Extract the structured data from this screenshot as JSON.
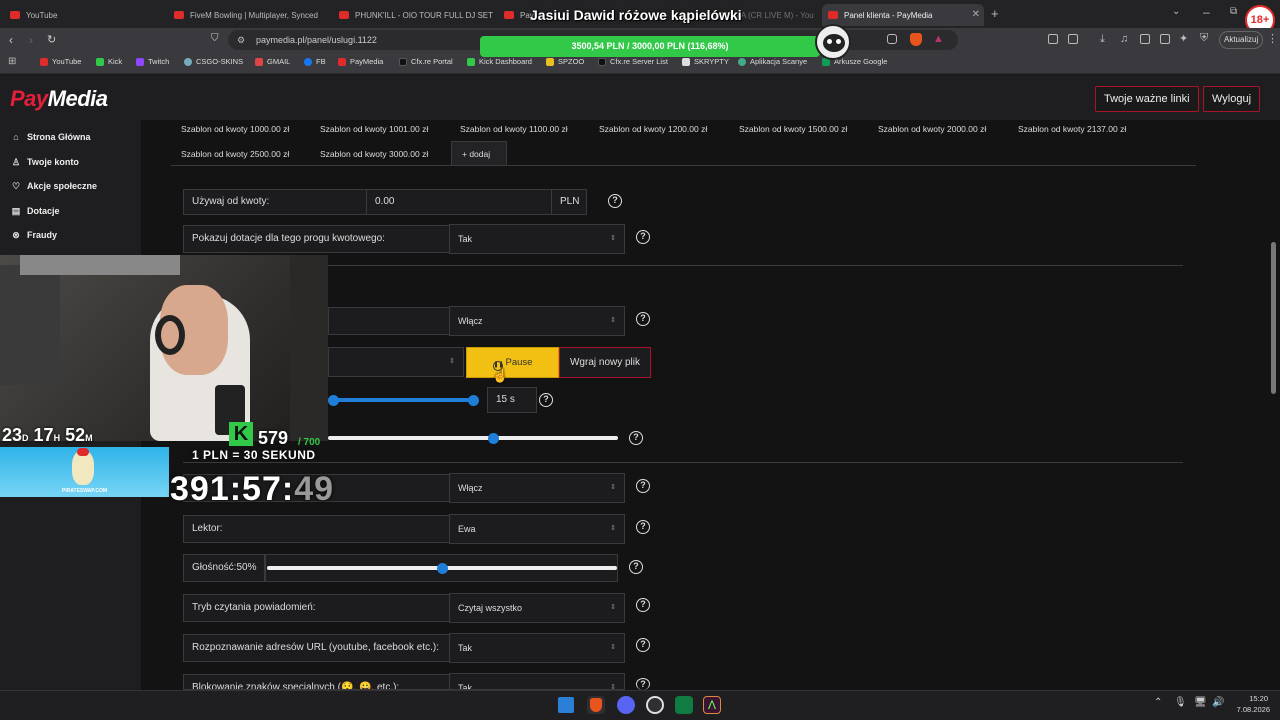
{
  "browser": {
    "tabs": [
      {
        "label": "YouTube"
      },
      {
        "label": "FiveM Bowling | Multiplayer, Synced"
      },
      {
        "label": "PHUNK'ILL - OIO TOUR FULL DJ SET"
      },
      {
        "label": "Pay"
      },
      {
        "label": "PAYMEDIA (CR LIVE M) - You"
      },
      {
        "label": "Panel klienta - PayMedia",
        "active": true
      }
    ],
    "url": "paymedia.pl/panel/uslugi.1122",
    "update_label": "Aktualizuj",
    "bookmarks": [
      "YouTube",
      "Kick",
      "Twitch",
      "CSGO-SKINS",
      "GMAIL",
      "FB",
      "PayMedia",
      "Cfx.re Portal",
      "Kick Dashboard",
      "SPZOO",
      "Cfx.re Server List",
      "SKRYPTY",
      "Aplikacja Scanye",
      "Arkusze Google"
    ],
    "badge": "18+"
  },
  "stream_overlay": {
    "goal_title": "Jasiui Dawid różowe kąpielówki",
    "goal_progress": "3500,54 PLN / 3000,00 PLN (116,68%)",
    "goal_fraction": 1.0,
    "countdown_d": "23",
    "countdown_h": "17",
    "countdown_m": "52",
    "d_unit": "D",
    "h_unit": "H",
    "m_unit": "M",
    "kick_count": "579",
    "kick_goal": "/ 700",
    "rate_label": "1 PLN = 30 SEKUND",
    "timer_main": "391:57:",
    "timer_sec": "49",
    "sponsor": "PIRATESWAP.COM"
  },
  "header": {
    "logo_pay": "Pay",
    "logo_media": "Media",
    "links_button": "Twoje ważne linki",
    "logout_button": "Wyloguj"
  },
  "sidebar": {
    "items": [
      {
        "label": "Strona Główna",
        "icon": "home-icon"
      },
      {
        "label": "Twoje konto",
        "icon": "user-icon"
      },
      {
        "label": "Akcje społeczne",
        "icon": "heart-icon"
      },
      {
        "label": "Dotacje",
        "icon": "document-icon"
      },
      {
        "label": "Fraudy",
        "icon": "ban-icon"
      }
    ]
  },
  "templates": {
    "row1": [
      "Szablon od kwoty 1000.00 zł",
      "Szablon od kwoty 1001.00 zł",
      "Szablon od kwoty 1100.00 zł",
      "Szablon od kwoty 1200.00 zł",
      "Szablon od kwoty 1500.00 zł",
      "Szablon od kwoty 2000.00 zł",
      "Szablon od kwoty 2137.00 zł"
    ],
    "row2": [
      "Szablon od kwoty 2500.00 zł",
      "Szablon od kwoty 3000.00 zł"
    ],
    "add_label": "+ dodaj"
  },
  "form": {
    "use_from_label": "Używaj od kwoty:",
    "use_from_value": "0.00",
    "currency": "PLN",
    "show_donations_label": "Pokazuj dotacje dla tego progu kwotowego:",
    "show_donations_value": "Tak",
    "sound_enabled_value": "Włącz",
    "pause_label": "Pause",
    "upload_label": "Wgraj nowy plik",
    "duration_value": "15 s",
    "tts_enabled_value": "Włącz",
    "lektor_label": "Lektor:",
    "lektor_value": "Ewa",
    "volume_label": "Głośność:50%",
    "volume_fraction": 0.5,
    "read_mode_label": "Tryb czytania powiadomień:",
    "read_mode_value": "Czytaj wszystko",
    "url_recognition_label": "Rozpoznawanie adresów URL (youtube, facebook etc.):",
    "url_recognition_value": "Tak",
    "special_chars_label": "Blokowanie znaków specjalnych (😯, 😀, etc.):",
    "special_chars_value": "Tak"
  },
  "taskbar": {
    "time": "15:20",
    "date": "7.08.2026"
  },
  "colors": {
    "brand_red": "#e51f3a",
    "accent_blue": "#1f7fd8",
    "pause_yellow": "#f2c012",
    "goal_green": "#32c848"
  }
}
